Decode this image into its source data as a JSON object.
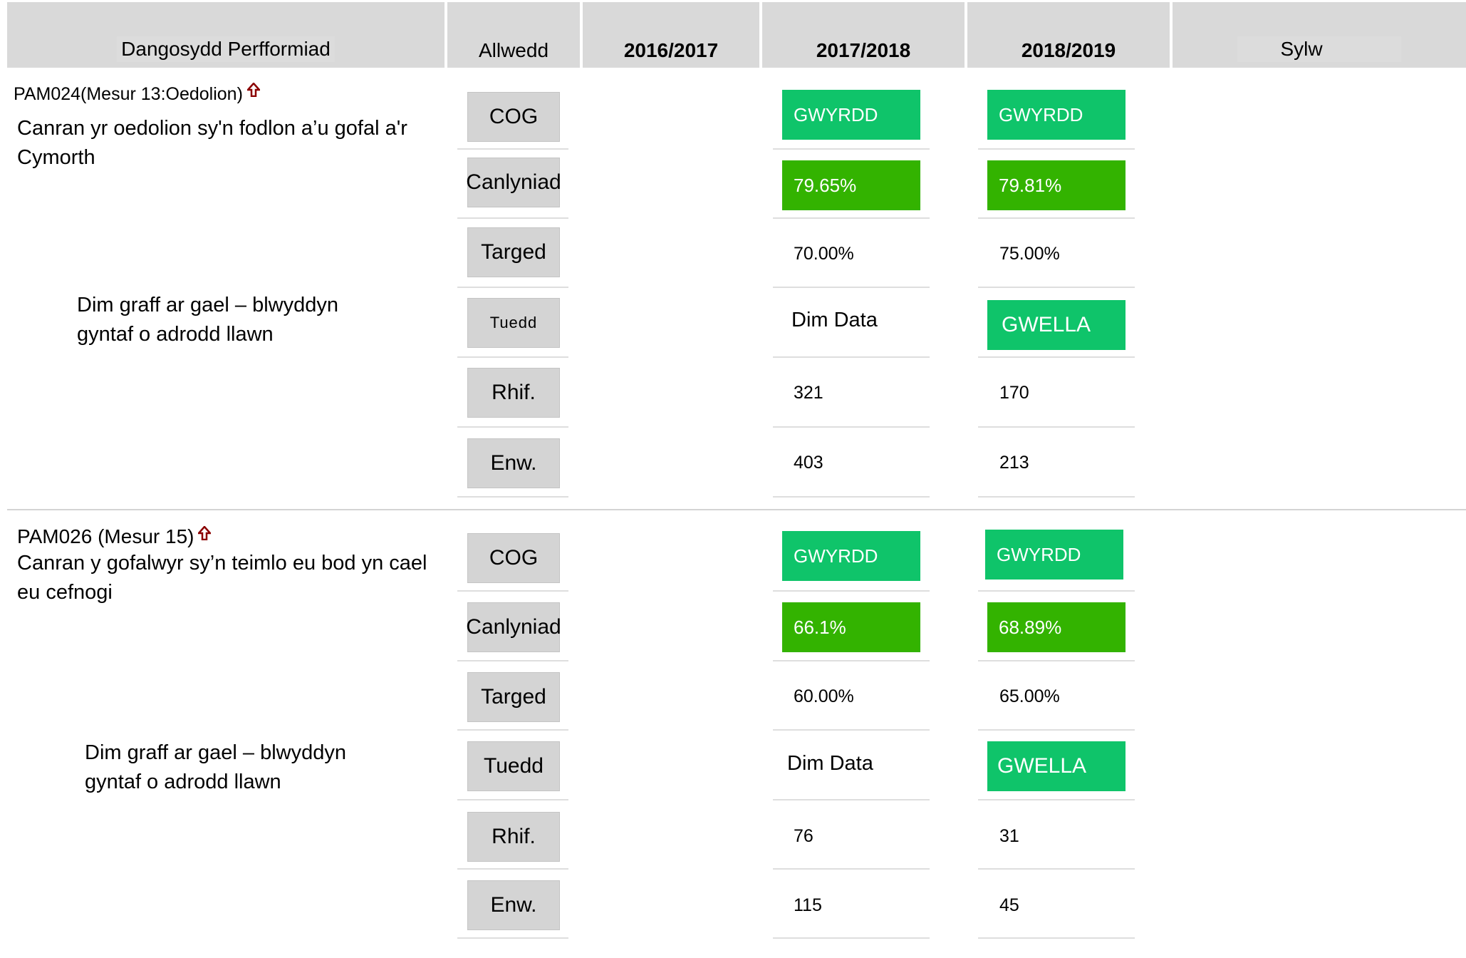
{
  "header": {
    "indicator": "Dangosydd Perfformiad",
    "key": "Allwedd",
    "y2016": "2016/2017",
    "y2017": "2017/2018",
    "y2018": "2018/2019",
    "comment": "Sylw"
  },
  "keys": {
    "rag": "COG",
    "result": "Canlyniad",
    "target": "Targed",
    "trend": "Tuedd",
    "numerator": "Rhif.",
    "denominator": "Enw."
  },
  "indicators": [
    {
      "code": "PAM024(Mesur 13:Oedolion)",
      "description": "Canran yr oedolion sy'n fodlon a’u gofal a'r Cymorth",
      "note_line1": "Dim graff ar gael – blwyddyn",
      "note_line2": "gyntaf o adrodd llawn",
      "y2017": {
        "rag": "GWYRDD",
        "result": "79.65%",
        "target": "70.00%",
        "trend": "Dim Data",
        "numerator": "321",
        "denominator": "403"
      },
      "y2018": {
        "rag": "GWYRDD",
        "result": "79.81%",
        "target": "75.00%",
        "trend": "GWELLA",
        "numerator": "170",
        "denominator": "213"
      }
    },
    {
      "code": "PAM026 (Mesur 15)",
      "description": "Canran y gofalwyr sy’n teimlo eu bod yn cael eu cefnogi",
      "note_line1": "Dim graff ar gael – blwyddyn",
      "note_line2": "gyntaf o adrodd llawn",
      "y2017": {
        "rag": "GWYRDD",
        "result": "66.1%",
        "target": "60.00%",
        "trend": "Dim Data",
        "numerator": "76",
        "denominator": "115"
      },
      "y2018": {
        "rag": "GWYRDD",
        "result": "68.89%",
        "target": "65.00%",
        "trend": "GWELLA",
        "numerator": "31",
        "denominator": "45"
      }
    }
  ],
  "colors": {
    "header_bg": "#d9d9d9",
    "rag_green": "#0fc46a",
    "result_green": "#33b300",
    "up_arrow": "#8b0000"
  },
  "icons": {
    "direction": "up-arrow-icon"
  }
}
